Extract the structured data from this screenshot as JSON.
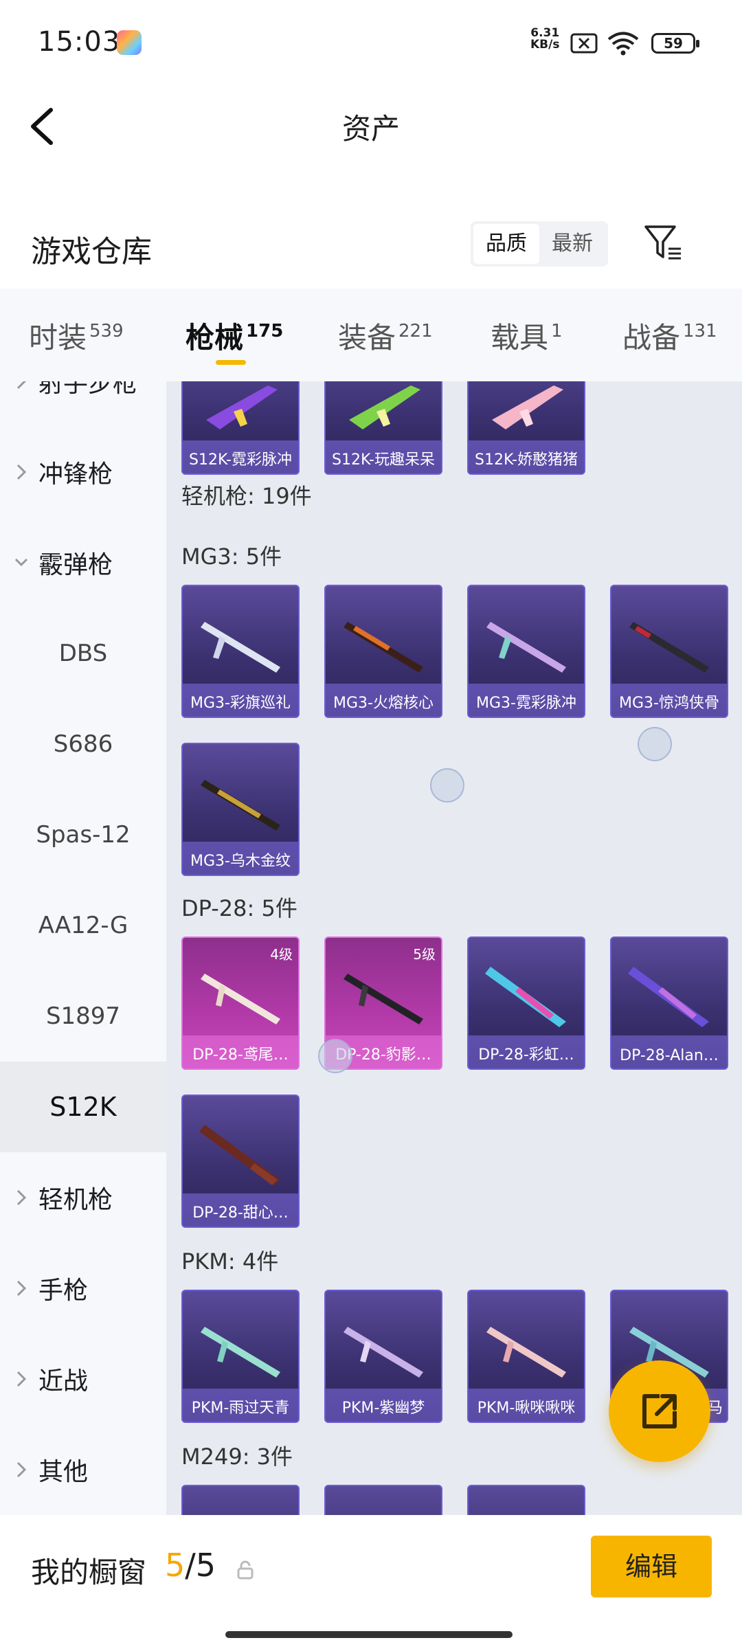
{
  "status": {
    "time": "15:03",
    "netspeed_top": "6.31",
    "netspeed_unit": "KB/s",
    "battery": "59"
  },
  "nav": {
    "title": "资产"
  },
  "warehouse": {
    "label": "游戏仓库",
    "sort": [
      "品质",
      "最新"
    ]
  },
  "tabs": [
    {
      "label": "时装",
      "count": "539"
    },
    {
      "label": "枪械",
      "count": "175"
    },
    {
      "label": "装备",
      "count": "221"
    },
    {
      "label": "载具",
      "count": "1"
    },
    {
      "label": "战备",
      "count": "131"
    }
  ],
  "sidebar": {
    "partial_top": "射手步枪",
    "smg": "冲锋枪",
    "shotgun": "霰弹枪",
    "subs": [
      "DBS",
      "S686",
      "Spas-12",
      "AA12-G",
      "S1897",
      "S12K"
    ],
    "lmg": "轻机枪",
    "pistol": "手枪",
    "melee": "近战",
    "other": "其他"
  },
  "content": {
    "top_cards": [
      "S12K-霓彩脉冲",
      "S12K-玩趣呆呆",
      "S12K-娇憨猪猪"
    ],
    "lmg_total": "轻机枪: 19件",
    "mg3_header": "MG3: 5件",
    "mg3": [
      "MG3-彩旗巡礼",
      "MG3-火熔核心",
      "MG3-霓彩脉冲",
      "MG3-惊鸿侠骨",
      "MG3-乌木金纹"
    ],
    "dp28_header": "DP-28: 5件",
    "dp28": [
      "DP-28-鸢尾…",
      "DP-28-豹影…",
      "DP-28-彩虹…",
      "DP-28-Alan…",
      "DP-28-甜心…"
    ],
    "dp28_levels": [
      "4级",
      "5级"
    ],
    "pkm_header": "PKM: 4件",
    "pkm": [
      "PKM-雨过天青",
      "PKM-紫幽梦",
      "PKM-啾咪啾咪",
      "…马"
    ],
    "m249_header": "M249: 3件"
  },
  "bottom": {
    "label": "我的橱窗",
    "count_current": "5",
    "count_total": "/5",
    "edit": "编辑"
  }
}
